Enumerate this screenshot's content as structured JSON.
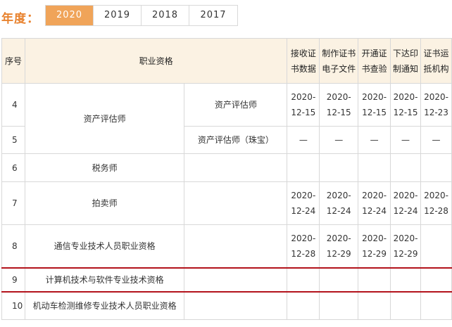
{
  "header": {
    "year_label": "年度：",
    "years": [
      {
        "label": "2020",
        "active": true
      },
      {
        "label": "2019",
        "active": false
      },
      {
        "label": "2018",
        "active": false
      },
      {
        "label": "2017",
        "active": false
      }
    ]
  },
  "table": {
    "headers": {
      "no": "序号",
      "qual": "职业资格",
      "c1": [
        "接收证",
        "书数据"
      ],
      "c2": [
        "制作证书",
        "电子文件"
      ],
      "c3": [
        "开通证",
        "书查验"
      ],
      "c4": [
        "下达印",
        "制通知"
      ],
      "c5": [
        "证书运",
        "抵机构"
      ]
    },
    "rows": [
      {
        "no": "4",
        "name": "资产评估师",
        "sub": "资产评估师",
        "dates": [
          [
            "2020-",
            "12-15"
          ],
          [
            "2020-",
            "12-15"
          ],
          [
            "2020-",
            "12-15"
          ],
          [
            "2020-",
            "12-15"
          ],
          [
            "2020-",
            "12-23"
          ]
        ]
      },
      {
        "no": "5",
        "sub": "资产评估师（珠宝）",
        "dates": [
          [
            "—"
          ],
          [
            "—"
          ],
          [
            "—"
          ],
          [
            "—"
          ],
          [
            "—"
          ]
        ]
      },
      {
        "no": "6",
        "name": "税务师",
        "sub": "",
        "dates": [
          [],
          [],
          [],
          [],
          []
        ]
      },
      {
        "no": "7",
        "name": "拍卖师",
        "sub": "",
        "dates": [
          [
            "2020-",
            "12-24"
          ],
          [
            "2020-",
            "12-24"
          ],
          [
            "2020-",
            "12-24"
          ],
          [
            "2020-",
            "12-24"
          ],
          [
            "2020-",
            "12-28"
          ]
        ]
      },
      {
        "no": "8",
        "name": "通信专业技术人员职业资格",
        "sub": "",
        "dates": [
          [
            "2020-",
            "12-28"
          ],
          [
            "2020-",
            "12-29"
          ],
          [
            "2020-",
            "12-29"
          ],
          [
            "2020-",
            "12-29"
          ],
          []
        ]
      },
      {
        "no": "9",
        "name": "计算机技术与软件专业技术资格",
        "sub": "",
        "dates": [
          [],
          [],
          [],
          [],
          []
        ]
      },
      {
        "no": "10",
        "name": "机动车检测维修专业技术人员职业资格",
        "sub": "",
        "dates": [
          [],
          [],
          [],
          [],
          []
        ]
      }
    ]
  }
}
